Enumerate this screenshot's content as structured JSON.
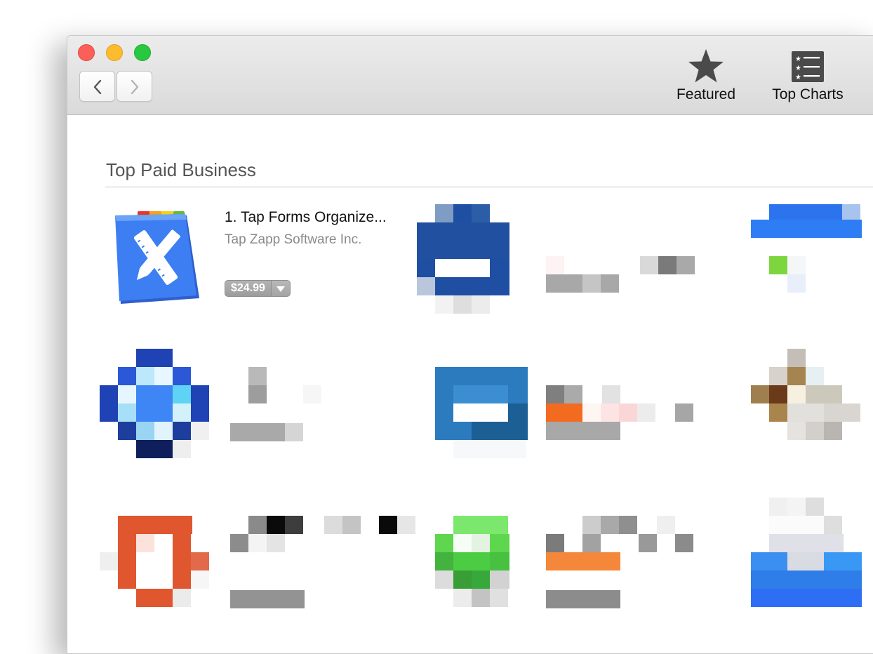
{
  "toolbar": {
    "featured_label": "Featured",
    "top_charts_label": "Top Charts"
  },
  "section": {
    "title": "Top Paid Business"
  },
  "apps": [
    {
      "name": "1. Tap Forms Organize...",
      "developer": "Tap Zapp Software Inc.",
      "price": "$24.99"
    }
  ],
  "colors": {
    "close": "#fc5f57",
    "minimize": "#fdbc2e",
    "maximize": "#28c840",
    "icon_blue": "#2d6ef0",
    "price_gray": "#a3a3a3"
  }
}
